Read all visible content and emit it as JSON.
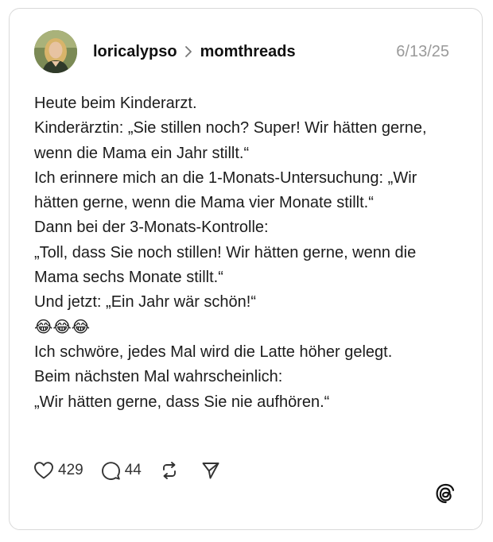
{
  "post": {
    "author": "loricalypso",
    "community": "momthreads",
    "date": "6/13/25",
    "text": "Heute beim Kinderarzt.\nKinderärztin: „Sie stillen noch? Super! Wir hätten gerne, wenn die Mama ein Jahr stillt.“\nIch erinnere mich an die 1-Monats-Untersuchung: „Wir hätten gerne, wenn die Mama vier Monate stillt.“\nDann bei der 3-Monats-Kontrolle:\n„Toll, dass Sie noch stillen! Wir hätten gerne, wenn die Mama sechs Monate stillt.“\nUnd jetzt: „Ein Jahr wär schön!“\n😂😂😂\nIch schwöre, jedes Mal wird die Latte höher gelegt.\nBeim nächsten Mal wahrscheinlich:\n„Wir hätten gerne, dass Sie nie aufhören.“"
  },
  "actions": {
    "likes": "429",
    "comments": "44"
  },
  "icons": {
    "like": "heart-icon",
    "comment": "comment-bubble-icon",
    "repost": "repost-icon",
    "share": "send-icon",
    "brand": "threads-logo-icon",
    "separator": "chevron-right-icon"
  }
}
